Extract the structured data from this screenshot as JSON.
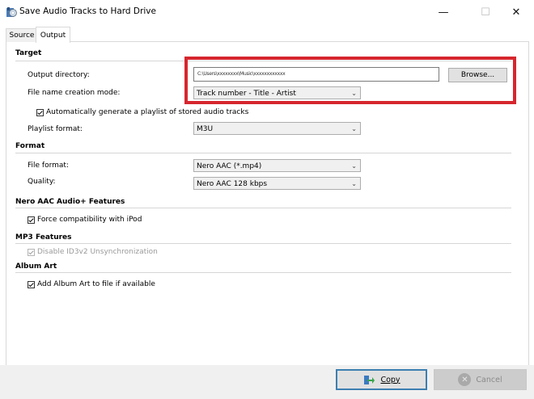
{
  "window": {
    "title": "Save Audio Tracks to Hard Drive",
    "minimize_glyph": "—",
    "maximize_glyph": "☐",
    "close_glyph": "✕"
  },
  "tabs": [
    {
      "label": "Source",
      "selected": false
    },
    {
      "label": "Output",
      "selected": true
    }
  ],
  "target": {
    "heading": "Target",
    "output_directory_label": "Output directory:",
    "output_directory_value": "C:\\Users\\xxxxxxxx\\Music\\xxxxxxxxxxxx",
    "browse_label": "Browse...",
    "file_name_mode_label": "File name creation mode:",
    "file_name_mode_value": "Track number - Title - Artist",
    "auto_playlist_label": "Automatically generate a playlist of stored audio tracks",
    "auto_playlist_checked": true,
    "playlist_format_label": "Playlist format:",
    "playlist_format_value": "M3U"
  },
  "format": {
    "heading": "Format",
    "file_format_label": "File format:",
    "file_format_value": "Nero AAC (*.mp4)",
    "quality_label": "Quality:",
    "quality_value": "Nero AAC 128 kbps"
  },
  "nero_aac": {
    "heading": "Nero AAC Audio+ Features",
    "force_ipod_label": "Force compatibility with iPod",
    "force_ipod_checked": true
  },
  "mp3": {
    "heading": "MP3 Features",
    "id3v2_label": "Disable ID3v2 Unsynchronization",
    "id3v2_checked": true,
    "id3v2_enabled": false
  },
  "album_art": {
    "heading": "Album Art",
    "add_art_label": "Add Album Art to file if available",
    "add_art_checked": true
  },
  "buttons": {
    "copy_label": "Copy",
    "cancel_label": "Cancel"
  },
  "icons": {
    "app": "audio-cd-icon",
    "copy": "copy-arrow-icon",
    "cancel": "cancel-x-icon",
    "dropdown": "chevron-down-icon"
  },
  "colors": {
    "highlight_box": "#d6262e",
    "focus_border": "#3c7fb1"
  }
}
